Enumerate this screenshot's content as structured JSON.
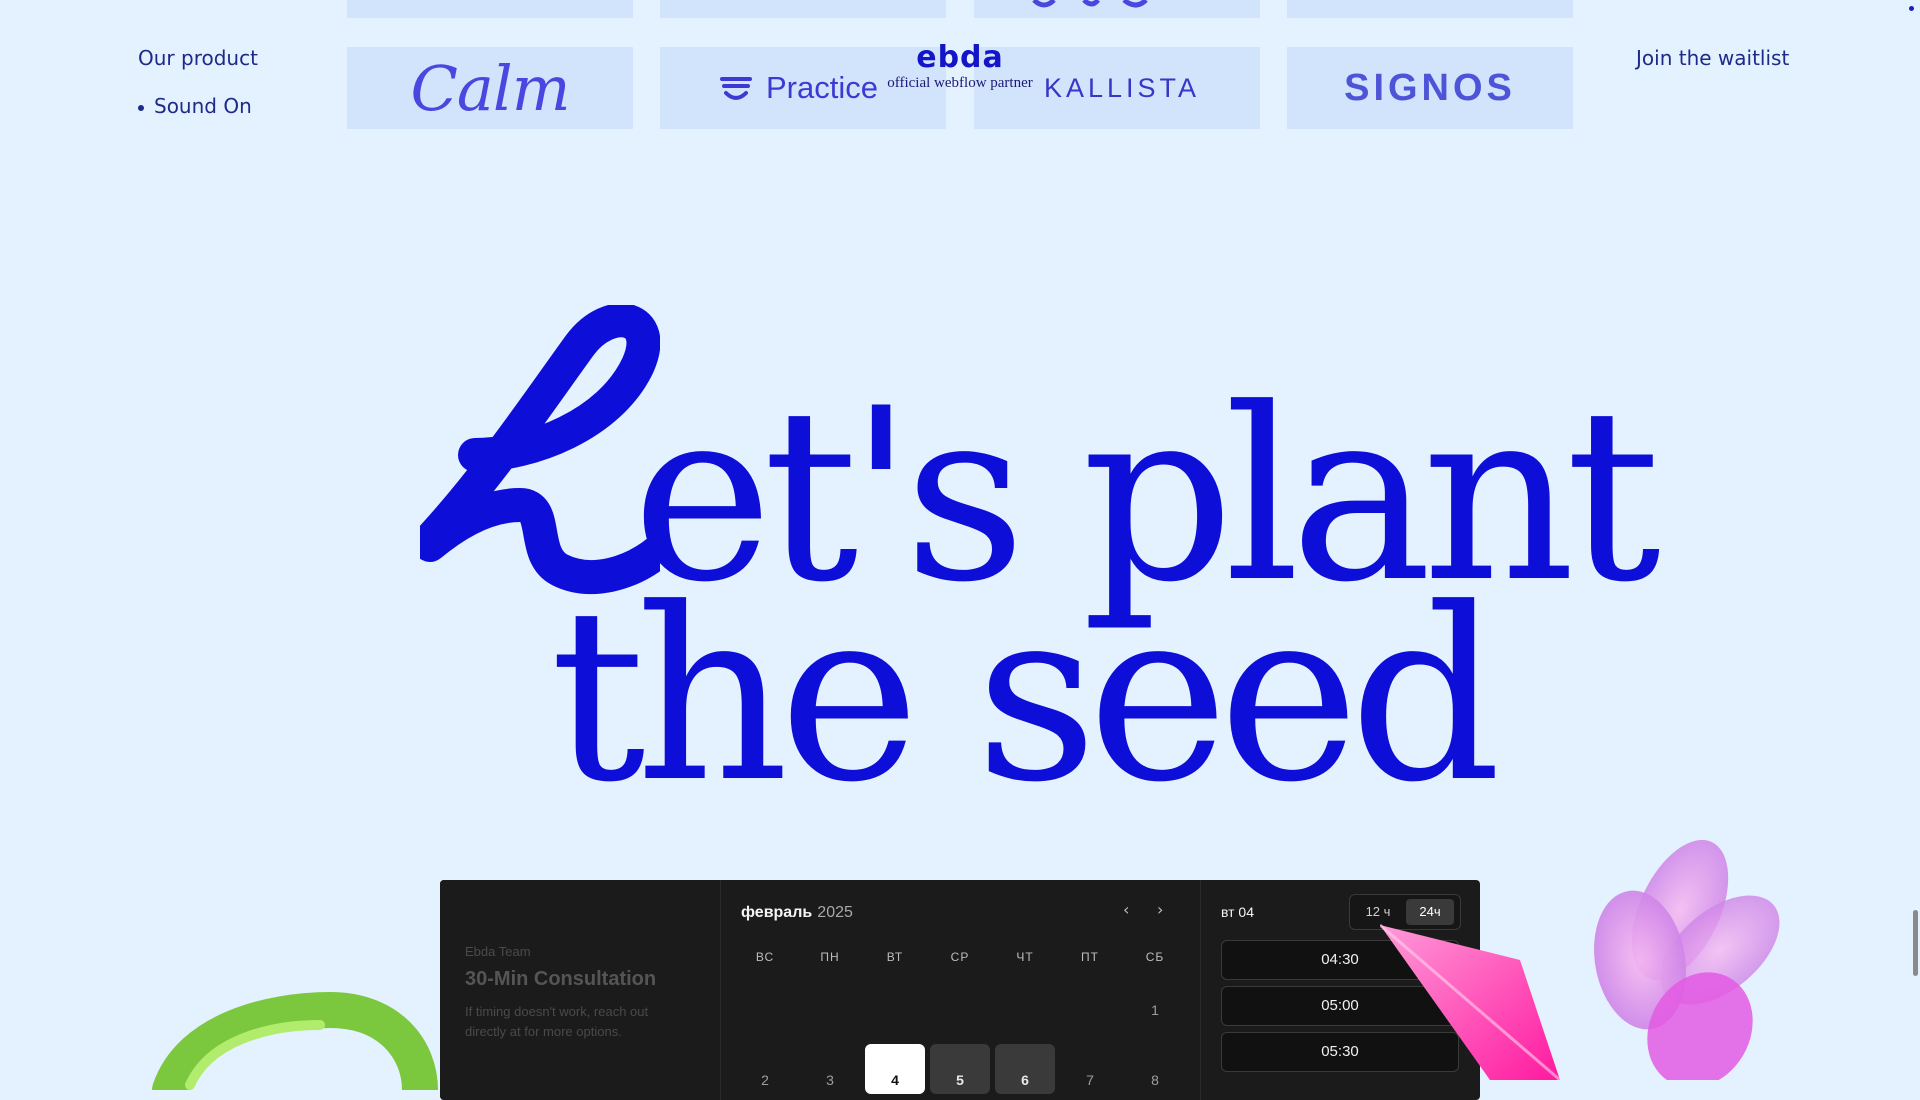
{
  "nav": {
    "our_product": "Our product",
    "sound_on": "Sound On",
    "join_waitlist": "Join the waitlist"
  },
  "logos": {
    "calm": "Calm",
    "practice": "Practice",
    "kallista": "KALLISTA",
    "signos": "SIGNOS"
  },
  "brand": {
    "name": "ebda",
    "tagline": "official webflow partner"
  },
  "hero": {
    "line1": "et's plant",
    "line2": "the seed"
  },
  "booking": {
    "team": "Ebda Team",
    "title": "30-Min Consultation",
    "note_before": "If timing doesn't work, reach out directly at",
    "note_link": "",
    "note_after": "for more options.",
    "month": "февраль",
    "year": "2025",
    "weekdays": [
      "ВС",
      "ПН",
      "ВТ",
      "СР",
      "ЧТ",
      "ПТ",
      "СБ"
    ],
    "days_row1": [
      "1"
    ],
    "days_row2": [
      "2",
      "3",
      "4",
      "5",
      "6",
      "7",
      "8"
    ],
    "selected_day_label": "вт 04",
    "format_12": "12 ч",
    "format_24": "24ч",
    "slots": [
      "04:30",
      "05:00",
      "05:30"
    ]
  },
  "colors": {
    "background": "#e4f1fe",
    "brand_blue": "#0d0fd8",
    "widget_bg": "#1b1b1b",
    "logo_card": "#d2e4fc"
  }
}
